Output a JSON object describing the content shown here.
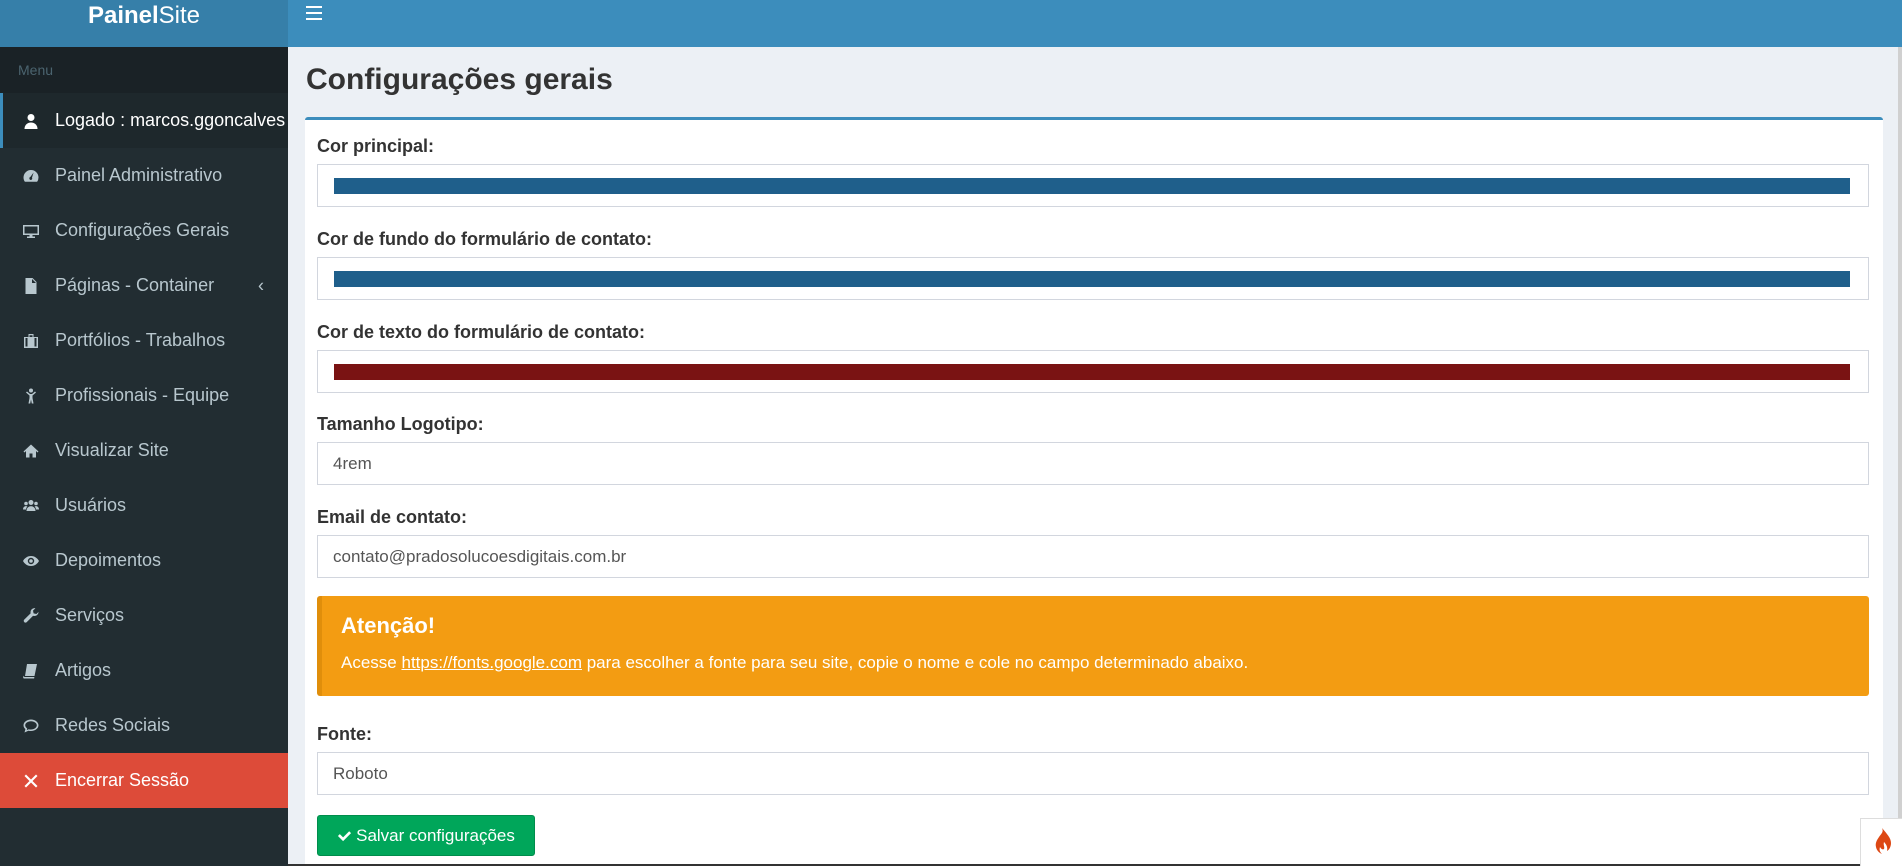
{
  "brand": {
    "bold": "Painel",
    "light": "Site"
  },
  "sidebar": {
    "header": "Menu",
    "items": [
      {
        "label": "Logado : marcos.ggoncalves",
        "icon": "user-icon"
      },
      {
        "label": "Painel Administrativo",
        "icon": "dashboard-icon"
      },
      {
        "label": "Configurações Gerais",
        "icon": "desktop-icon"
      },
      {
        "label": "Páginas - Container",
        "icon": "file-icon",
        "caret": "‹"
      },
      {
        "label": "Portfólios - Trabalhos",
        "icon": "suitcase-icon"
      },
      {
        "label": "Profissionais - Equipe",
        "icon": "child-icon"
      },
      {
        "label": "Visualizar Site",
        "icon": "home-icon"
      },
      {
        "label": "Usuários",
        "icon": "users-icon"
      },
      {
        "label": "Depoimentos",
        "icon": "eye-icon"
      },
      {
        "label": "Serviços",
        "icon": "wrench-icon"
      },
      {
        "label": "Artigos",
        "icon": "book-icon"
      },
      {
        "label": "Redes Sociais",
        "icon": "comments-icon"
      },
      {
        "label": "Encerrar Sessão",
        "icon": "close-icon"
      }
    ]
  },
  "page": {
    "title": "Configurações gerais",
    "fields": {
      "main_color": {
        "label": "Cor principal:",
        "value": "#1f5f8b"
      },
      "form_bg_color": {
        "label": "Cor de fundo do formulário de contato:",
        "value": "#1f5f8b"
      },
      "form_text_color": {
        "label": "Cor de texto do formulário de contato:",
        "value": "#7a1313"
      },
      "logo_size": {
        "label": "Tamanho Logotipo:",
        "value": "4rem"
      },
      "contact_email": {
        "label": "Email de contato:",
        "value": "contato@pradosolucoesdigitais.com.br"
      },
      "font": {
        "label": "Fonte:",
        "value": "Roboto"
      }
    },
    "alert": {
      "title": "Atenção!",
      "prefix": "Acesse ",
      "link": "https://fonts.google.com",
      "suffix": " para escolher a fonte para seu site, copie o nome e cole no campo determinado abaixo."
    },
    "save_label": "Salvar configurações"
  },
  "colors": {
    "topbar": "#3c8dbc",
    "sidebar": "#222d32",
    "logout": "#dd4b39",
    "alert": "#f39c12",
    "save_button": "#00a65a"
  }
}
